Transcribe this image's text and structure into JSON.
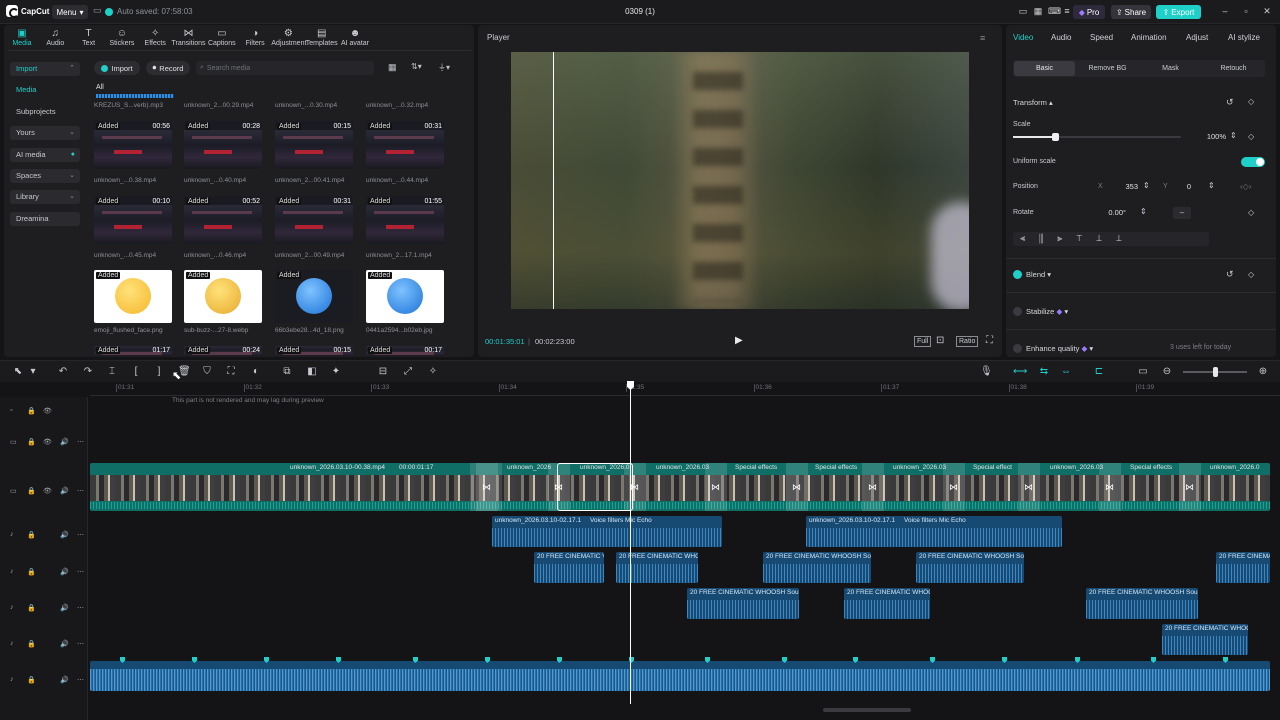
{
  "app": {
    "name": "CapCut",
    "menu": "Menu",
    "autosave": "Auto saved: 07:58:03",
    "project_title": "0309 (1)",
    "pro": "Pro",
    "share": "Share",
    "export": "Export"
  },
  "toolbar": [
    {
      "label": "Media",
      "icon": "media-icon"
    },
    {
      "label": "Audio",
      "icon": "audio-icon"
    },
    {
      "label": "Text",
      "icon": "text-icon"
    },
    {
      "label": "Stickers",
      "icon": "stickers-icon"
    },
    {
      "label": "Effects",
      "icon": "effects-icon"
    },
    {
      "label": "Transitions",
      "icon": "transitions-icon"
    },
    {
      "label": "Captions",
      "icon": "captions-icon"
    },
    {
      "label": "Filters",
      "icon": "filters-icon"
    },
    {
      "label": "Adjustment",
      "icon": "adjustment-icon"
    },
    {
      "label": "Templates",
      "icon": "templates-icon"
    },
    {
      "label": "AI avatar",
      "icon": "ai-avatar-icon"
    }
  ],
  "sidebar": {
    "items": [
      "Import",
      "Media",
      "Subprojects",
      "Yours",
      "AI media",
      "Spaces",
      "Library",
      "Dreamina"
    ]
  },
  "media": {
    "import_btn": "Import",
    "record_btn": "Record",
    "search_placeholder": "Search media",
    "filter_all": "All",
    "row0": [
      "KREZUS_S...verb).mp3",
      "unknown_2...00.29.mp4",
      "unknown_...0.30.mp4",
      "unknown_...0.32.mp4"
    ],
    "row1": [
      {
        "added": "Added",
        "dur": "00:56",
        "name": "unknown_...0.38.mp4"
      },
      {
        "added": "Added",
        "dur": "00:28",
        "name": "unknown_...0.40.mp4"
      },
      {
        "added": "Added",
        "dur": "00:15",
        "name": "unknown_2...00.41.mp4"
      },
      {
        "added": "Added",
        "dur": "00:31",
        "name": "unknown_...0.44.mp4"
      }
    ],
    "row2": [
      {
        "added": "Added",
        "dur": "00:10",
        "name": "unknown_...0.45.mp4"
      },
      {
        "added": "Added",
        "dur": "00:52",
        "name": "unknown_...0.46.mp4"
      },
      {
        "added": "Added",
        "dur": "00:31",
        "name": "unknown_2...00.49.mp4"
      },
      {
        "added": "Added",
        "dur": "01:55",
        "name": "unknown_2...17.1.mp4"
      }
    ],
    "row3": [
      {
        "added": "Added",
        "name": "emoji_flushed_face.png"
      },
      {
        "added": "Added",
        "name": "sub-buzz-...27-8.webp"
      },
      {
        "added": "Added",
        "name": "66b3ebe28...4d_18.png"
      },
      {
        "added": "Added",
        "name": "0441a2594...b02eb.jpg"
      }
    ],
    "row4": [
      {
        "added": "Added",
        "dur": "01:17"
      },
      {
        "added": "Added",
        "dur": "00:24"
      },
      {
        "added": "Added",
        "dur": "00:15"
      },
      {
        "added": "Added",
        "dur": "00:17"
      }
    ]
  },
  "player": {
    "title": "Player",
    "current_time": "00:01:35:01",
    "total_time": "00:02:23:00",
    "full_label": "Full",
    "ratio_label": "Ratio"
  },
  "inspector": {
    "tabs": [
      "Video",
      "Audio",
      "Speed",
      "Animation",
      "Adjust",
      "AI stylize"
    ],
    "subtabs": [
      "Basic",
      "Remove BG",
      "Mask",
      "Retouch"
    ],
    "transform": "Transform",
    "scale_label": "Scale",
    "scale_value": "100%",
    "scale_level": 0.25,
    "uniform_scale": "Uniform scale",
    "position_label": "Position",
    "x_label": "X",
    "x_value": "353",
    "y_label": "Y",
    "y_value": "0",
    "rotate_label": "Rotate",
    "rotate_value": "0.00°",
    "blend": "Blend",
    "stabilize": "Stabilize",
    "enhance": "Enhance quality",
    "uses_left": "3 uses left for today"
  },
  "timeline": {
    "tooltip": "This part is not rendered and may lag during preview",
    "ticks": [
      "01:31",
      "01:32",
      "01:33",
      "01:34",
      "01:35",
      "01:36",
      "01:37",
      "01:38",
      "01:39"
    ],
    "video_clip_names": [
      "unknown_2026.03.10-00.38.mp4",
      "00:00:01:17",
      "unknown_2026",
      "unknown_2026.0",
      "unknown_2026.03",
      "Special effects",
      "Special effects",
      "unknown_2026.03",
      "Special effect",
      "unknown_2026.03",
      "Special effects",
      "unknown_2026.0"
    ],
    "audio1": [
      "unknown_2026.03.10-02.17.1",
      "Voice filters Mic Echo",
      "unknown_2026.03.10-02.17.1",
      "Voice filters Mic Echo"
    ],
    "audio2": [
      "20 FREE CINEMATIC V",
      "20 FREE CINEMATIC WHO",
      "20 FREE CINEMATIC WHOOSH Sou",
      "20 FREE CINEMATIC WHOOSH Sou",
      "20 FREE CINEMA"
    ],
    "audio3": [
      "20 FREE CINEMATIC WHOOSH Sou",
      "20 FREE CINEMATIC WHOC",
      "20 FREE CINEMATIC WHOOSH Sou"
    ],
    "audio4": [
      "20 FREE CINEMATIC WHOC"
    ]
  },
  "colors": {
    "accent": "#1fd0c9",
    "bg": "#141416",
    "panel": "#1e1e21",
    "audio_clip": "#174a72",
    "video_track": "#0f6f66"
  }
}
